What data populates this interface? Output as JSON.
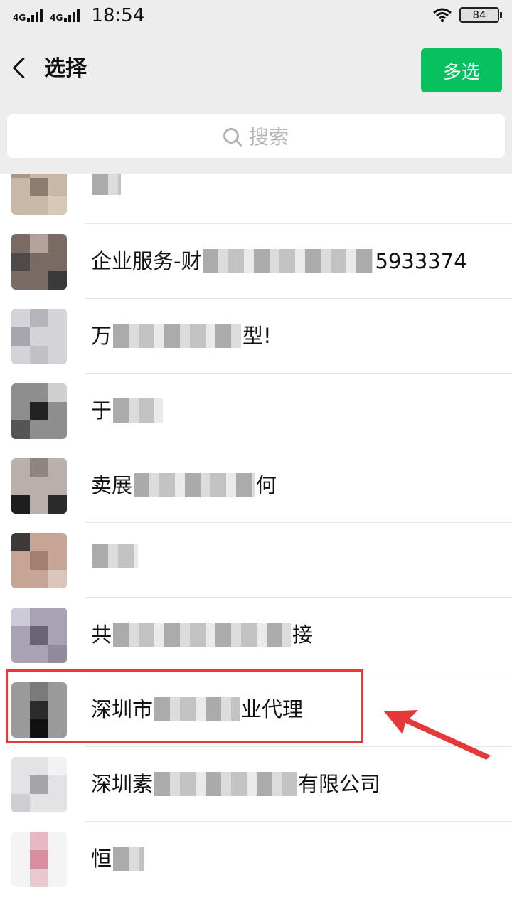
{
  "status_bar": {
    "network_1": "4G",
    "network_2": "4G",
    "time": "18:54",
    "battery": "84"
  },
  "header": {
    "title": "选择",
    "multi_select_label": "多选"
  },
  "search": {
    "placeholder": "搜索"
  },
  "contacts": [
    {
      "prefix": "",
      "suffix": ""
    },
    {
      "prefix": "企业服务-财",
      "suffix": "5933374"
    },
    {
      "prefix": "万",
      "suffix": "型!"
    },
    {
      "prefix": "于",
      "suffix": ""
    },
    {
      "prefix": "卖展",
      "suffix": "何"
    },
    {
      "prefix": "",
      "suffix": ""
    },
    {
      "prefix": "共",
      "suffix": "接"
    },
    {
      "prefix": "深圳市",
      "suffix": "业代理"
    },
    {
      "prefix": "深圳素",
      "suffix": "有限公司"
    },
    {
      "prefix": "恒",
      "suffix": ""
    }
  ],
  "colors": {
    "accent_green": "#07c160",
    "header_bg": "#ededed",
    "annotation_red": "#e5383b"
  }
}
